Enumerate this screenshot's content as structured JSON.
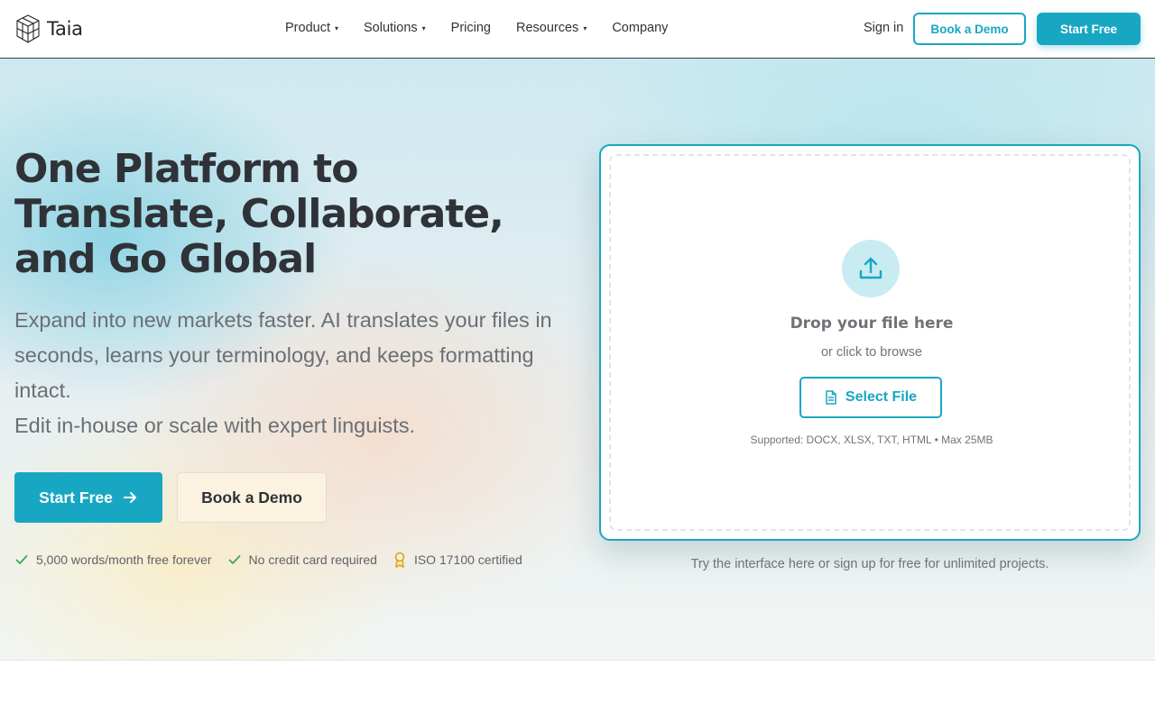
{
  "brand": {
    "name": "Taia",
    "logo_icon": "cube-logo-icon"
  },
  "nav": {
    "items": [
      {
        "label": "Product",
        "has_dropdown": true
      },
      {
        "label": "Solutions",
        "has_dropdown": true
      },
      {
        "label": "Pricing",
        "has_dropdown": false
      },
      {
        "label": "Resources",
        "has_dropdown": true
      },
      {
        "label": "Company",
        "has_dropdown": false
      }
    ],
    "caret": "▾"
  },
  "header": {
    "signin_label": "Sign in",
    "book_demo_label": "Book a Demo",
    "start_free_label": "Start Free"
  },
  "hero": {
    "title": "One Platform to Translate, Collaborate, and Go Global",
    "subtitle_line1": "Expand into new markets faster. AI translates your files in seconds, learns your terminology, and keeps formatting intact.",
    "subtitle_line2": "Edit in-house or scale with expert linguists.",
    "start_free_label": "Start Free",
    "book_demo_label": "Book a Demo",
    "features": [
      {
        "icon": "check-icon",
        "label": "5,000 words/month free forever"
      },
      {
        "icon": "check-icon",
        "label": "No credit card required"
      },
      {
        "icon": "award-ribbon-icon",
        "label": "ISO 17100 certified"
      }
    ]
  },
  "upload": {
    "title": "Drop your file here",
    "subtitle": "or click to browse",
    "button_label": "Select File",
    "supported": "Supported: DOCX, XLSX, TXT, HTML • Max 25MB",
    "footer_note": "Try the interface here or sign up for free for unlimited projects."
  },
  "colors": {
    "accent": "#17a7c3",
    "text_dark": "#2f3338",
    "text_muted": "#6b6f74",
    "check_green": "#3aa856",
    "award_gold": "#e0a800"
  }
}
